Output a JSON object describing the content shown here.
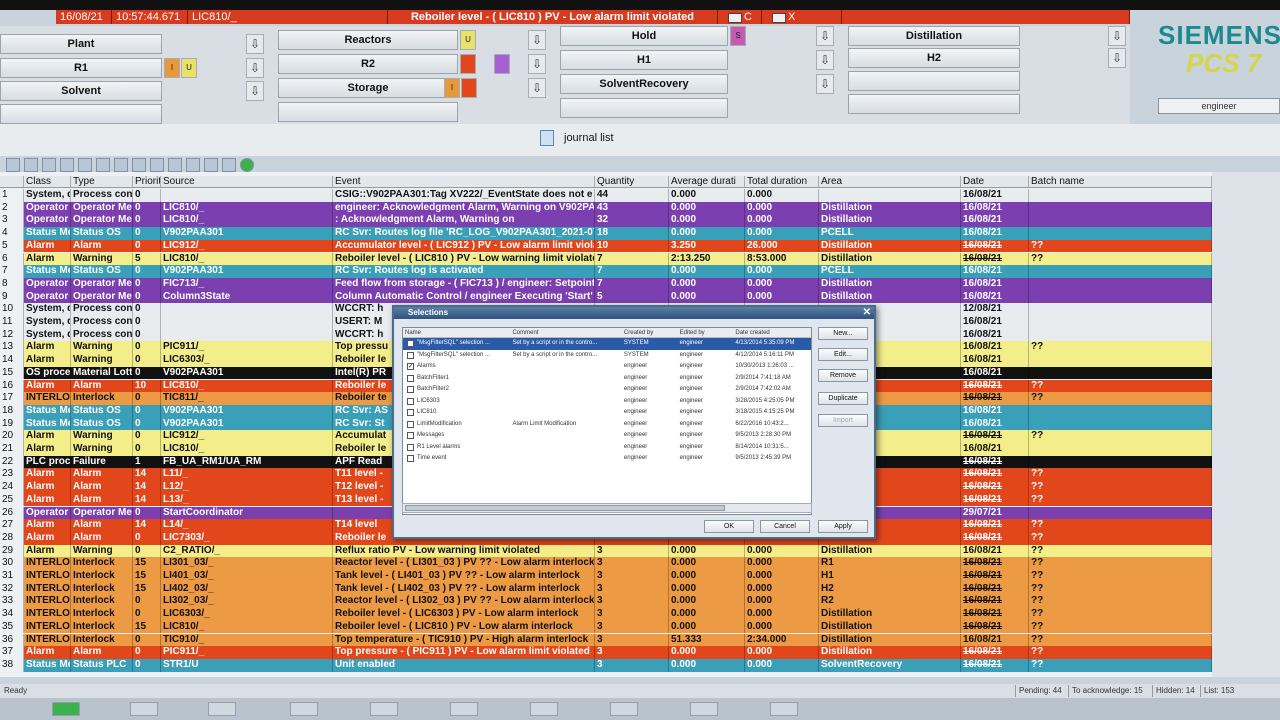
{
  "alarm_line": {
    "date": "16/08/21",
    "time": "10:57:44.671",
    "tag": "LIC810/_",
    "message": "Reboiler level - ( LIC810 ) PV - Low alarm limit violated",
    "c_label": "C",
    "x_label": "X"
  },
  "plant_buttons": [
    {
      "label": "Plant"
    },
    {
      "label": "Reactors"
    },
    {
      "label": "Hold"
    },
    {
      "label": "Distillation"
    },
    {
      "label": "R1"
    },
    {
      "label": "R2"
    },
    {
      "label": "H1"
    },
    {
      "label": "H2"
    },
    {
      "label": "Solvent"
    },
    {
      "label": "Storage"
    },
    {
      "label": "SolventRecovery"
    },
    {
      "label": ""
    }
  ],
  "slot_marks": {
    "u": "U",
    "i": "I",
    "s": "S"
  },
  "logo": {
    "brand": "SIEMENS",
    "product": "PCS 7"
  },
  "user": "engineer",
  "view_title": "journal list",
  "columns": [
    "Class",
    "Type",
    "Priorit",
    "Source",
    "Event",
    "Quantity",
    "Average durati",
    "Total duration",
    "Area",
    "Date",
    "Batch name"
  ],
  "rows": [
    {
      "n": "1",
      "cls": "System, d",
      "type": "Process cont",
      "prio": "0",
      "src": "",
      "event": "CSIG::V902PAA301:Tag XV222/_EventState does not e",
      "qty": "44",
      "avg": "0.000",
      "tot": "0.000",
      "area": "",
      "date": "16/08/21",
      "batch": "",
      "color": "#e8ecef",
      "fg": "#111",
      "strike": false
    },
    {
      "n": "2",
      "cls": "Operator",
      "type": "Operator Me",
      "prio": "0",
      "src": "LIC810/_",
      "event": "engineer: Acknowledgment Alarm, Warning on V902PA",
      "qty": "43",
      "avg": "0.000",
      "tot": "0.000",
      "area": "Distillation",
      "date": "16/08/21",
      "batch": "",
      "color": "#7b3fb0",
      "fg": "#fff",
      "strike": false
    },
    {
      "n": "3",
      "cls": "Operator",
      "type": "Operator Me",
      "prio": "0",
      "src": "LIC810/_",
      "event": ": Acknowledgment Alarm, Warning on",
      "qty": "32",
      "avg": "0.000",
      "tot": "0.000",
      "area": "Distillation",
      "date": "16/08/21",
      "batch": "",
      "color": "#7b3fb0",
      "fg": "#fff",
      "strike": false
    },
    {
      "n": "4",
      "cls": "Status Me",
      "type": "Status OS",
      "prio": "0",
      "src": "V902PAA301",
      "event": "RC Svr: Routes log file 'RC_LOG_V902PAA301_2021-07",
      "qty": "18",
      "avg": "0.000",
      "tot": "0.000",
      "area": "PCELL",
      "date": "16/08/21",
      "batch": "",
      "color": "#3a9fb8",
      "fg": "#fff",
      "strike": false
    },
    {
      "n": "5",
      "cls": "Alarm",
      "type": "Alarm",
      "prio": "0",
      "src": "LIC912/_",
      "event": "Accumulator level - ( LIC912 ) PV - Low alarm limit violat",
      "qty": "10",
      "avg": "3.250",
      "tot": "26.000",
      "area": "Distillation",
      "date": "16/08/21",
      "batch": "??",
      "color": "#e2471c",
      "fg": "#fff",
      "strike": true
    },
    {
      "n": "6",
      "cls": "Alarm",
      "type": "Warning",
      "prio": "5",
      "src": "LIC810/_",
      "event": "Reboiler level - ( LIC810 ) PV - Low warning limit violate",
      "qty": "7",
      "avg": "2:13.250",
      "tot": "8:53.000",
      "area": "Distillation",
      "date": "16/08/21",
      "batch": "??",
      "color": "#f3ee8a",
      "fg": "#111",
      "strike": true
    },
    {
      "n": "7",
      "cls": "Status Me",
      "type": "Status OS",
      "prio": "0",
      "src": "V902PAA301",
      "event": "RC Svr: Routes log is activated",
      "qty": "7",
      "avg": "0.000",
      "tot": "0.000",
      "area": "PCELL",
      "date": "16/08/21",
      "batch": "",
      "color": "#3a9fb8",
      "fg": "#fff",
      "strike": false
    },
    {
      "n": "8",
      "cls": "Operator",
      "type": "Operator Me",
      "prio": "0",
      "src": "FIC713/_",
      "event": "Feed flow from storage - ( FIC713 ) / engineer: Setpoint",
      "qty": "7",
      "avg": "0.000",
      "tot": "0.000",
      "area": "Distillation",
      "date": "16/08/21",
      "batch": "",
      "color": "#7b3fb0",
      "fg": "#fff",
      "strike": false
    },
    {
      "n": "9",
      "cls": "Operator",
      "type": "Operator Me",
      "prio": "0",
      "src": "Column3State",
      "event": "Column Automatic Control / engineer Executing 'Start'",
      "qty": "5",
      "avg": "0.000",
      "tot": "0.000",
      "area": "Distillation",
      "date": "16/08/21",
      "batch": "",
      "color": "#7b3fb0",
      "fg": "#fff",
      "strike": false
    },
    {
      "n": "10",
      "cls": "System, d",
      "type": "Process cont",
      "prio": "0",
      "src": "",
      "event": "WCCRT: h",
      "qty": "",
      "avg": "",
      "tot": "",
      "area": "",
      "date": "12/08/21",
      "batch": "",
      "color": "#e8ecef",
      "fg": "#111",
      "strike": false
    },
    {
      "n": "11",
      "cls": "System, d",
      "type": "Process cont",
      "prio": "0",
      "src": "",
      "event": "USERT: M",
      "qty": "",
      "avg": "",
      "tot": "",
      "area": "",
      "date": "16/08/21",
      "batch": "",
      "color": "#e8ecef",
      "fg": "#111",
      "strike": false
    },
    {
      "n": "12",
      "cls": "System, d",
      "type": "Process cont",
      "prio": "0",
      "src": "",
      "event": "WCCRT: h",
      "qty": "",
      "avg": "",
      "tot": "",
      "area": "",
      "date": "16/08/21",
      "batch": "",
      "color": "#e8ecef",
      "fg": "#111",
      "strike": false
    },
    {
      "n": "13",
      "cls": "Alarm",
      "type": "Warning",
      "prio": "0",
      "src": "PIC911/_",
      "event": "Top pressu",
      "qty": "",
      "avg": "",
      "tot": "",
      "area": "",
      "date": "16/08/21",
      "batch": "??",
      "color": "#f3ee8a",
      "fg": "#111",
      "strike": false
    },
    {
      "n": "14",
      "cls": "Alarm",
      "type": "Warning",
      "prio": "0",
      "src": "LIC6303/_",
      "event": "Reboiler le",
      "qty": "",
      "avg": "",
      "tot": "",
      "area": "",
      "date": "16/08/21",
      "batch": "",
      "color": "#f3ee8a",
      "fg": "#111",
      "strike": false
    },
    {
      "n": "15",
      "cls": "OS proce",
      "type": "Material Lott",
      "prio": "0",
      "src": "V902PAA301",
      "event": "Intel(R) PR",
      "qty": "",
      "avg": "",
      "tot": "",
      "area": "",
      "date": "16/08/21",
      "batch": "",
      "color": "#111",
      "fg": "#fff",
      "strike": false
    },
    {
      "n": "16",
      "cls": "Alarm",
      "type": "Alarm",
      "prio": "10",
      "src": "LIC810/_",
      "event": "Reboiler le",
      "qty": "",
      "avg": "",
      "tot": "",
      "area": "",
      "date": "16/08/21",
      "batch": "??",
      "color": "#e2471c",
      "fg": "#fff",
      "strike": true
    },
    {
      "n": "17",
      "cls": "INTERLO",
      "type": "Interlock",
      "prio": "0",
      "src": "TIC811/_",
      "event": "Reboiler te",
      "qty": "",
      "avg": "",
      "tot": "",
      "area": "",
      "date": "16/08/21",
      "batch": "??",
      "color": "#ec9a44",
      "fg": "#111",
      "strike": true
    },
    {
      "n": "18",
      "cls": "Status Me",
      "type": "Status OS",
      "prio": "0",
      "src": "V902PAA301",
      "event": "RC Svr: AS",
      "qty": "",
      "avg": "",
      "tot": "",
      "area": "",
      "date": "16/08/21",
      "batch": "",
      "color": "#3a9fb8",
      "fg": "#fff",
      "strike": false
    },
    {
      "n": "19",
      "cls": "Status Me",
      "type": "Status OS",
      "prio": "0",
      "src": "V902PAA301",
      "event": "RC Svr: St",
      "qty": "",
      "avg": "",
      "tot": "",
      "area": "",
      "date": "16/08/21",
      "batch": "",
      "color": "#3a9fb8",
      "fg": "#fff",
      "strike": false
    },
    {
      "n": "20",
      "cls": "Alarm",
      "type": "Warning",
      "prio": "0",
      "src": "LIC912/_",
      "event": "Accumulat",
      "qty": "",
      "avg": "",
      "tot": "",
      "area": "",
      "date": "16/08/21",
      "batch": "??",
      "color": "#f3ee8a",
      "fg": "#111",
      "strike": true
    },
    {
      "n": "21",
      "cls": "Alarm",
      "type": "Warning",
      "prio": "0",
      "src": "LIC810/_",
      "event": "Reboiler le",
      "qty": "",
      "avg": "",
      "tot": "",
      "area": "",
      "date": "16/08/21",
      "batch": "",
      "color": "#f3ee8a",
      "fg": "#111",
      "strike": false
    },
    {
      "n": "22",
      "cls": "PLC proc",
      "type": "Failure",
      "prio": "1",
      "src": "FB_UA_RM1/UA_RM",
      "event": "APF Read",
      "qty": "",
      "avg": "",
      "tot": "",
      "area": "",
      "date": "16/08/21",
      "batch": "",
      "color": "#111",
      "fg": "#fff",
      "strike": true
    },
    {
      "n": "23",
      "cls": "Alarm",
      "type": "Alarm",
      "prio": "14",
      "src": "L11/_",
      "event": "T11 level -",
      "qty": "",
      "avg": "",
      "tot": "",
      "area": "",
      "date": "16/08/21",
      "batch": "??",
      "color": "#e2471c",
      "fg": "#fff",
      "strike": true
    },
    {
      "n": "24",
      "cls": "Alarm",
      "type": "Alarm",
      "prio": "14",
      "src": "L12/_",
      "event": "T12 level -",
      "qty": "",
      "avg": "",
      "tot": "",
      "area": "",
      "date": "16/08/21",
      "batch": "??",
      "color": "#e2471c",
      "fg": "#fff",
      "strike": true
    },
    {
      "n": "25",
      "cls": "Alarm",
      "type": "Alarm",
      "prio": "14",
      "src": "L13/_",
      "event": "T13 level -",
      "qty": "",
      "avg": "",
      "tot": "",
      "area": "",
      "date": "16/08/21",
      "batch": "??",
      "color": "#e2471c",
      "fg": "#fff",
      "strike": true
    },
    {
      "n": "26",
      "cls": "Operator",
      "type": "Operator Me",
      "prio": "0",
      "src": "StartCoordinator",
      "event": "",
      "qty": "",
      "avg": "",
      "tot": "",
      "area": "",
      "date": "29/07/21",
      "batch": "",
      "color": "#7b3fb0",
      "fg": "#fff",
      "strike": false
    },
    {
      "n": "27",
      "cls": "Alarm",
      "type": "Alarm",
      "prio": "14",
      "src": "L14/_",
      "event": "T14 level",
      "qty": "",
      "avg": "",
      "tot": "",
      "area": "",
      "date": "16/08/21",
      "batch": "??",
      "color": "#e2471c",
      "fg": "#fff",
      "strike": true
    },
    {
      "n": "28",
      "cls": "Alarm",
      "type": "Alarm",
      "prio": "0",
      "src": "LIC7303/_",
      "event": "Reboiler le",
      "qty": "",
      "avg": "",
      "tot": "",
      "area": "",
      "date": "16/08/21",
      "batch": "??",
      "color": "#e2471c",
      "fg": "#fff",
      "strike": true
    },
    {
      "n": "29",
      "cls": "Alarm",
      "type": "Warning",
      "prio": "0",
      "src": "C2_RATIO/_",
      "event": "Reflux ratio PV - Low warning limit violated",
      "qty": "3",
      "avg": "0.000",
      "tot": "0.000",
      "area": "Distillation",
      "date": "16/08/21",
      "batch": "??",
      "color": "#f3ee8a",
      "fg": "#111",
      "strike": false
    },
    {
      "n": "30",
      "cls": "INTERLO",
      "type": "Interlock",
      "prio": "15",
      "src": "LI301_03/_",
      "event": "Reactor level - ( LI301_03 ) PV ?? - Low alarm interlock",
      "qty": "3",
      "avg": "0.000",
      "tot": "0.000",
      "area": "R1",
      "date": "16/08/21",
      "batch": "??",
      "color": "#ec9a44",
      "fg": "#111",
      "strike": true
    },
    {
      "n": "31",
      "cls": "INTERLO",
      "type": "Interlock",
      "prio": "15",
      "src": "LI401_03/_",
      "event": "Tank level - ( LI401_03 ) PV ?? - Low alarm interlock",
      "qty": "3",
      "avg": "0.000",
      "tot": "0.000",
      "area": "H1",
      "date": "16/08/21",
      "batch": "??",
      "color": "#ec9a44",
      "fg": "#111",
      "strike": true
    },
    {
      "n": "32",
      "cls": "INTERLO",
      "type": "Interlock",
      "prio": "15",
      "src": "LI402_03/_",
      "event": "Tank level - ( LI402_03 ) PV ?? - Low alarm interlock",
      "qty": "3",
      "avg": "0.000",
      "tot": "0.000",
      "area": "H2",
      "date": "16/08/21",
      "batch": "??",
      "color": "#ec9a44",
      "fg": "#111",
      "strike": true
    },
    {
      "n": "33",
      "cls": "INTERLO",
      "type": "Interlock",
      "prio": "0",
      "src": "LI302_03/_",
      "event": "Reactor level - ( LI302_03 ) PV ?? - Low alarm interlock",
      "qty": "3",
      "avg": "0.000",
      "tot": "0.000",
      "area": "R2",
      "date": "16/08/21",
      "batch": "??",
      "color": "#ec9a44",
      "fg": "#111",
      "strike": true
    },
    {
      "n": "34",
      "cls": "INTERLO",
      "type": "Interlock",
      "prio": "0",
      "src": "LIC6303/_",
      "event": "Reboiler level - ( LIC6303 ) PV - Low alarm interlock",
      "qty": "3",
      "avg": "0.000",
      "tot": "0.000",
      "area": "Distillation",
      "date": "16/08/21",
      "batch": "??",
      "color": "#ec9a44",
      "fg": "#111",
      "strike": true
    },
    {
      "n": "35",
      "cls": "INTERLO",
      "type": "Interlock",
      "prio": "15",
      "src": "LIC810/_",
      "event": "Reboiler level - ( LIC810 ) PV - Low alarm interlock",
      "qty": "3",
      "avg": "0.000",
      "tot": "0.000",
      "area": "Distillation",
      "date": "16/08/21",
      "batch": "??",
      "color": "#ec9a44",
      "fg": "#111",
      "strike": true
    },
    {
      "n": "36",
      "cls": "INTERLO",
      "type": "Interlock",
      "prio": "0",
      "src": "TIC910/_",
      "event": "Top temperature - ( TIC910 ) PV - High alarm interlock",
      "qty": "3",
      "avg": "51.333",
      "tot": "2:34.000",
      "area": "Distillation",
      "date": "16/08/21",
      "batch": "??",
      "color": "#ec9a44",
      "fg": "#111",
      "strike": false
    },
    {
      "n": "37",
      "cls": "Alarm",
      "type": "Alarm",
      "prio": "0",
      "src": "PIC911/_",
      "event": "Top pressure - ( PIC911 ) PV - Low alarm limit violated",
      "qty": "3",
      "avg": "0.000",
      "tot": "0.000",
      "area": "Distillation",
      "date": "16/08/21",
      "batch": "??",
      "color": "#e2471c",
      "fg": "#fff",
      "strike": true
    },
    {
      "n": "38",
      "cls": "Status Me",
      "type": "Status PLC",
      "prio": "0",
      "src": "STR1/U",
      "event": "Unit enabled",
      "qty": "3",
      "avg": "0.000",
      "tot": "0.000",
      "area": "SolventRecovery",
      "date": "16/08/21",
      "batch": "??",
      "color": "#3a9fb8",
      "fg": "#fff",
      "strike": true
    }
  ],
  "dialog": {
    "title": "Selections",
    "columns": [
      "Name",
      "Comment",
      "Created by",
      "Edited by",
      "Date created"
    ],
    "items": [
      {
        "name": "\"MsgFilterSQL\" selection ...",
        "comment": "Set by a script or in the contro...",
        "created": "SYSTEM",
        "edited": "engineer",
        "date": "4/13/2014 5:35:09 PM",
        "checked": false,
        "selected": true
      },
      {
        "name": "\"MsgFilterSQL\" selection ...",
        "comment": "Set by a script or in the contro...",
        "created": "SYSTEM",
        "edited": "engineer",
        "date": "4/12/2014 5:16:11 PM",
        "checked": false,
        "selected": false
      },
      {
        "name": "Alarms",
        "comment": "",
        "created": "engineer",
        "edited": "engineer",
        "date": "10/30/2013 1:26:03 ...",
        "checked": true,
        "selected": false
      },
      {
        "name": "BatchFilter1",
        "comment": "",
        "created": "engineer",
        "edited": "engineer",
        "date": "2/9/2014 7:41:18 AM",
        "checked": false,
        "selected": false
      },
      {
        "name": "BatchFilter2",
        "comment": "",
        "created": "engineer",
        "edited": "engineer",
        "date": "2/9/2014 7:42:02 AM",
        "checked": false,
        "selected": false
      },
      {
        "name": "LIC6303",
        "comment": "",
        "created": "engineer",
        "edited": "engineer",
        "date": "3/28/2015 4:25:05 PM",
        "checked": false,
        "selected": false
      },
      {
        "name": "LIC810",
        "comment": "",
        "created": "engineer",
        "edited": "engineer",
        "date": "3/18/2015 4:15:25 PM",
        "checked": false,
        "selected": false
      },
      {
        "name": "LimitModification",
        "comment": "Alarm Limit Modification",
        "created": "engineer",
        "edited": "engineer",
        "date": "6/22/2016 10:43:2...",
        "checked": false,
        "selected": false
      },
      {
        "name": "Messages",
        "comment": "",
        "created": "engineer",
        "edited": "engineer",
        "date": "9/5/2013 2:28:30 PM",
        "checked": false,
        "selected": false
      },
      {
        "name": "R1 Level alarms",
        "comment": "",
        "created": "engineer",
        "edited": "engineer",
        "date": "8/14/2014 10:31:5...",
        "checked": false,
        "selected": false
      },
      {
        "name": "Time event",
        "comment": "",
        "created": "engineer",
        "edited": "engineer",
        "date": "9/5/2013 2:45:39 PM",
        "checked": false,
        "selected": false
      }
    ],
    "buttons": {
      "new": "New...",
      "edit": "Edit...",
      "remove": "Remove",
      "duplicate": "Duplicate",
      "import": "Import",
      "ok": "OK",
      "cancel": "Cancel",
      "apply": "Apply"
    }
  },
  "status": {
    "ready": "Ready",
    "pending": "Pending: 44",
    "to_ack": "To acknowledge: 15",
    "hidden": "Hidden: 14",
    "list": "List: 153"
  }
}
